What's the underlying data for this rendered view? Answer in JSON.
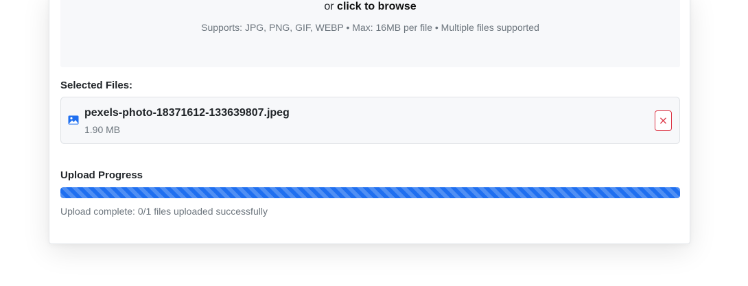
{
  "dropzone": {
    "prefix": "or",
    "action": "click to browse",
    "supports": "Supports: JPG, PNG, GIF, WEBP • Max: 16MB per file • Multiple files supported"
  },
  "selected_files": {
    "label": "Selected Files:",
    "items": [
      {
        "name": "pexels-photo-18371612-133639807.jpeg",
        "size": "1.90 MB",
        "icon": "image-icon",
        "remove_label": "×"
      }
    ]
  },
  "upload": {
    "label": "Upload Progress",
    "progress": 1.0,
    "status": "Upload complete: 0/1 files uploaded successfully"
  },
  "colors": {
    "accent": "#1f6ff0",
    "danger": "#dc3545",
    "muted": "#6c757d"
  }
}
